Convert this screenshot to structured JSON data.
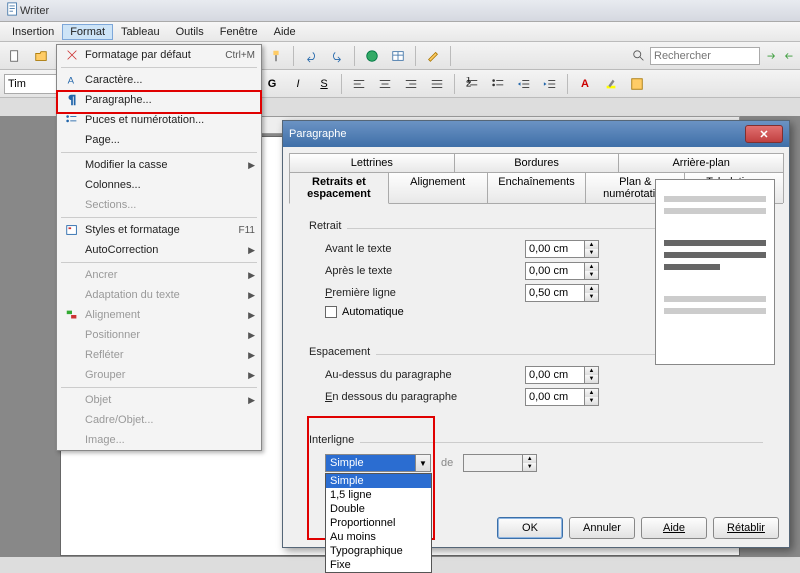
{
  "app": {
    "title": "Writer"
  },
  "menu": {
    "items": [
      "Insertion",
      "Format",
      "Tableau",
      "Outils",
      "Fenêtre",
      "Aide"
    ],
    "active_index": 1
  },
  "search": {
    "placeholder": "Rechercher"
  },
  "font_combo_value": "Tim",
  "format_menu": {
    "items": [
      {
        "label": "Formatage par défaut",
        "shortcut": "Ctrl+M",
        "icon": "clear-format-icon"
      },
      {
        "label": "Caractère...",
        "icon": "character-icon"
      },
      {
        "label": "Paragraphe...",
        "icon": "paragraph-icon",
        "highlighted": true
      },
      {
        "label": "Puces et numérotation...",
        "icon": "bullets-icon"
      },
      {
        "label": "Page...",
        "icon": ""
      },
      {
        "label": "Modifier la casse",
        "submenu": true
      },
      {
        "label": "Colonnes...",
        "icon": ""
      },
      {
        "label": "Sections...",
        "icon": "",
        "disabled": true
      },
      {
        "label": "Styles et formatage",
        "shortcut": "F11",
        "icon": "styles-icon"
      },
      {
        "label": "AutoCorrection",
        "submenu": true
      },
      {
        "label": "Ancrer",
        "submenu": true,
        "disabled": true
      },
      {
        "label": "Adaptation du texte",
        "submenu": true,
        "disabled": true
      },
      {
        "label": "Alignement",
        "submenu": true,
        "icon": "align-icon",
        "disabled": true
      },
      {
        "label": "Positionner",
        "submenu": true,
        "disabled": true
      },
      {
        "label": "Refléter",
        "submenu": true,
        "disabled": true
      },
      {
        "label": "Grouper",
        "submenu": true,
        "disabled": true
      },
      {
        "label": "Objet",
        "submenu": true,
        "disabled": true
      },
      {
        "label": "Cadre/Objet...",
        "disabled": true
      },
      {
        "label": "Image...",
        "disabled": true
      }
    ]
  },
  "dialog": {
    "title": "Paragraphe",
    "tabs_row1": [
      "Lettrines",
      "Bordures",
      "Arrière-plan"
    ],
    "tabs_row2": [
      "Retraits et espacement",
      "Alignement",
      "Enchaînements",
      "Plan & numérotation",
      "Tabulations"
    ],
    "active_tab": "Retraits et espacement",
    "groups": {
      "retrait": {
        "title": "Retrait",
        "before_label": "Avant le texte",
        "before_value": "0,00 cm",
        "after_label": "Après le texte",
        "after_value": "0,00 cm",
        "first_label_pre": "P",
        "first_label_rest": "remière ligne",
        "first_value": "0,50 cm",
        "auto_label_pre": "A",
        "auto_label_rest": "utomatique"
      },
      "espacement": {
        "title": "Espacement",
        "above_label": "Au-dessus du paragraphe",
        "above_value": "0,00 cm",
        "below_label_pre": "E",
        "below_label_rest": "n dessous du paragraphe",
        "below_value": "0,00 cm"
      },
      "interligne": {
        "title": "Interligne",
        "selected": "Simple",
        "de_label": "d",
        "value": "",
        "options": [
          "Simple",
          "1,5 ligne",
          "Double",
          "Proportionnel",
          "Au moins",
          "Typographique",
          "Fixe"
        ]
      }
    },
    "buttons": {
      "ok": "OK",
      "cancel": "Annuler",
      "help": "Aide",
      "reset": "Rétablir"
    }
  }
}
